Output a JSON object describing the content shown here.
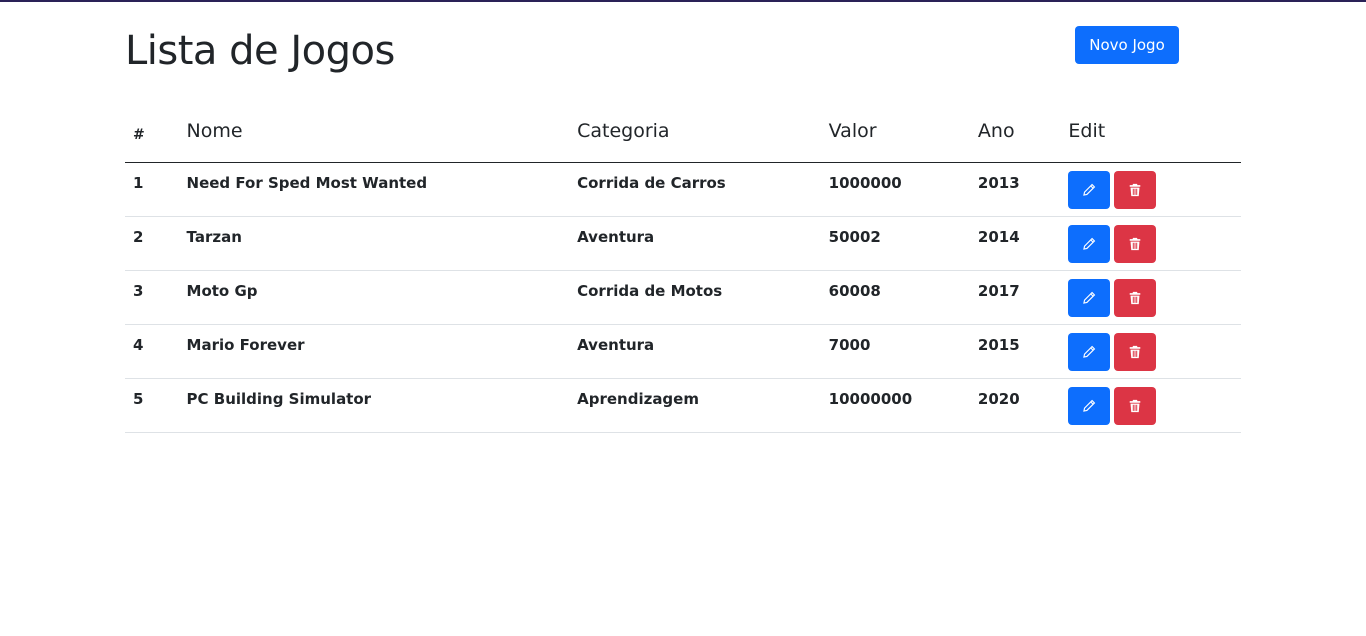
{
  "page": {
    "title": "Lista de Jogos",
    "new_button_label": "Novo Jogo"
  },
  "table": {
    "headers": {
      "num": "#",
      "nome": "Nome",
      "categoria": "Categoria",
      "valor": "Valor",
      "ano": "Ano",
      "edit": "Edit"
    },
    "rows": [
      {
        "num": "1",
        "nome": "Need For Sped Most Wanted",
        "categoria": "Corrida de Carros",
        "valor": "1000000",
        "ano": "2013"
      },
      {
        "num": "2",
        "nome": "Tarzan",
        "categoria": "Aventura",
        "valor": "50002",
        "ano": "2014"
      },
      {
        "num": "3",
        "nome": "Moto Gp",
        "categoria": "Corrida de Motos",
        "valor": "60008",
        "ano": "2017"
      },
      {
        "num": "4",
        "nome": "Mario Forever",
        "categoria": "Aventura",
        "valor": "7000",
        "ano": "2015"
      },
      {
        "num": "5",
        "nome": "PC Building Simulator",
        "categoria": "Aprendizagem",
        "valor": "10000000",
        "ano": "2020"
      }
    ]
  },
  "icons": {
    "edit": "pencil-icon",
    "delete": "trash-icon"
  },
  "colors": {
    "primary": "#0d6efd",
    "danger": "#dc3545",
    "text": "#212529",
    "top_border": "#2a2157"
  }
}
